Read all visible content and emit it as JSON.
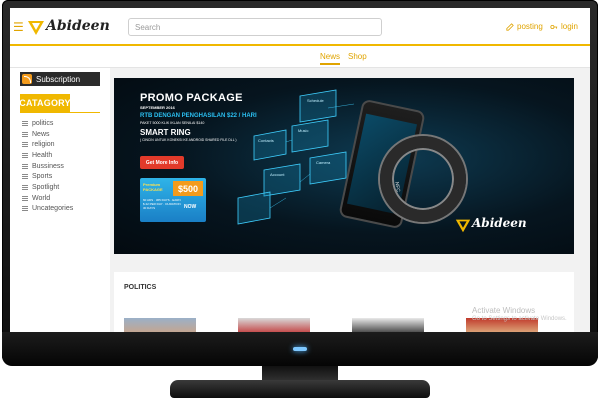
{
  "header": {
    "logo_text": "Abideen",
    "search_placeholder": "Search",
    "posting_label": "posting",
    "login_label": "login",
    "accent_color": "#f0b800"
  },
  "tabs": [
    {
      "label": "News",
      "active": true
    },
    {
      "label": "Shop",
      "active": false
    }
  ],
  "sidebar": {
    "subscription_label": "Subscription",
    "category_heading": "CATAGORY",
    "categories": [
      "politics",
      "News",
      "religion",
      "Health",
      "Bussiness",
      "Sports",
      "Spotlight",
      "World",
      "Uncategories"
    ]
  },
  "banner": {
    "title": "PROMO PACKAGE",
    "date": "SEPTEMBER 2016",
    "line1": "RTB  DENGAN PENGHASILAN $22 / HARI",
    "line2": "PAKET  5000 KLIK IKLAN SENILAI $140",
    "line3": "SMART RING",
    "line4": "( CINCIN UNTUK KONEKSI KE ANDROID SHARED FILE DLL )",
    "button_label": "Get More Info",
    "card_label": "Premium PACKAGE",
    "card_price": "$500",
    "card_text": "60 ADS · 365 DAYS · EARN $ 22 PER DAY · DURATION 30 DAYS",
    "card_now": "NOW",
    "panel_labels": [
      "Schedule",
      "Music",
      "Contacts",
      "Camera",
      "Account"
    ],
    "ring_text": "NFC",
    "logo_text": "Abideen"
  },
  "politics": {
    "title": "POLITICS"
  },
  "watermark": {
    "title": "Activate Windows",
    "subtitle": "Go to Settings to activate Windows."
  }
}
